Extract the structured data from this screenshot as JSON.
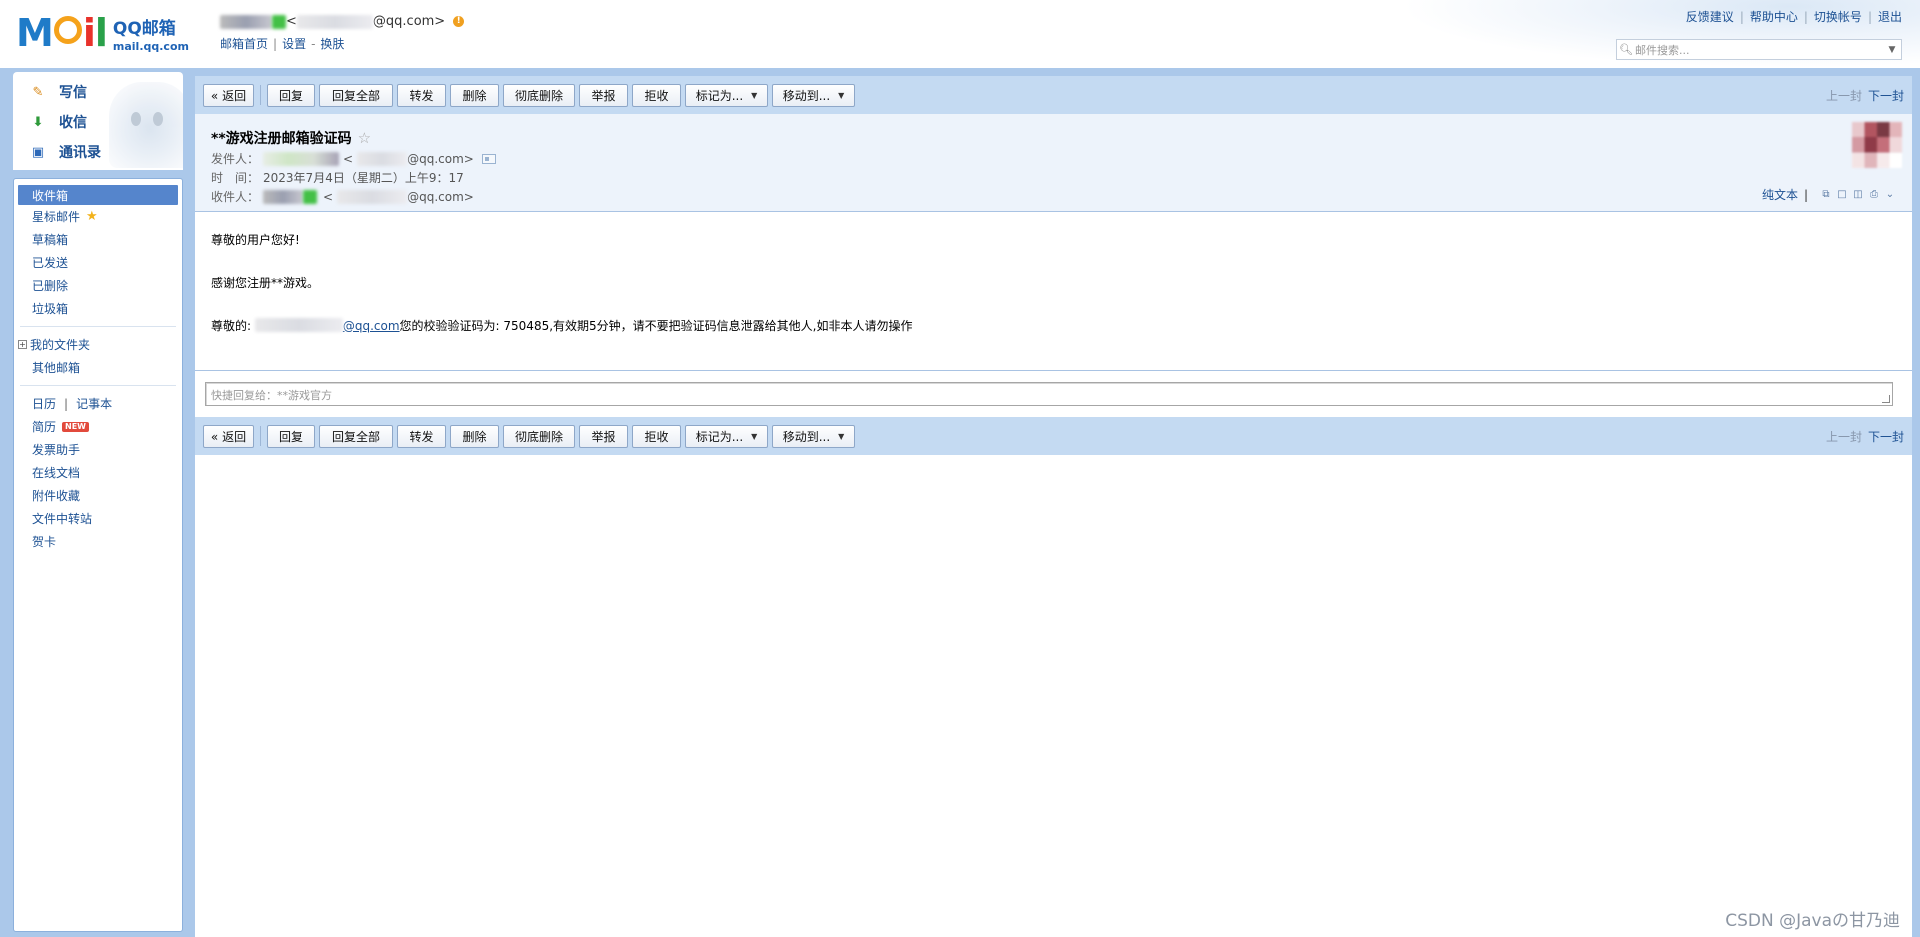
{
  "logo": {
    "mark": "M",
    "mark_i": "i",
    "mark_l": "l",
    "name_cn": "QQ邮箱",
    "domain": "mail.qq.com"
  },
  "account": {
    "email_suffix": "@qq.com>",
    "bracket": "<",
    "links": [
      "邮箱首页",
      "设置",
      "换肤"
    ],
    "sep1": "|",
    "sep2": "-"
  },
  "top_links": [
    "反馈建议",
    "帮助中心",
    "切换帐号",
    "退出"
  ],
  "top_sep": "|",
  "search": {
    "placeholder": "邮件搜索...",
    "icon": "search-icon"
  },
  "sidebar_top": {
    "write": "写信",
    "inbox": "收信",
    "contacts": "通讯录"
  },
  "sidebar": {
    "inbox": "收件箱",
    "starred": "星标邮件",
    "drafts": "草稿箱",
    "sent": "已发送",
    "deleted": "已删除",
    "spam": "垃圾箱",
    "my_folders": "我的文件夹",
    "other_mail": "其他邮箱",
    "calendar": "日历",
    "notes": "记事本",
    "nav_pipe": "|",
    "resume": "简历",
    "new_badge": "NEW",
    "invoice": "发票助手",
    "docs": "在线文档",
    "attachments": "附件收藏",
    "transfer": "文件中转站",
    "cards": "贺卡"
  },
  "toolbar": {
    "back": "« 返回",
    "reply": "回复",
    "reply_all": "回复全部",
    "forward": "转发",
    "delete": "删除",
    "delete_forever": "彻底删除",
    "report": "举报",
    "reject": "拒收",
    "mark_as": "标记为...",
    "move_to": "移动到...",
    "prev": "上一封",
    "next": "下一封"
  },
  "mail": {
    "subject": "**游戏注册邮箱验证码",
    "sender_label": "发件人：",
    "sender_email_suffix": "@qq.com>",
    "bracket": "<",
    "time_label": "时　间：",
    "time_value": "2023年7月4日（星期二）上午9：17",
    "recipient_label": "收件人：",
    "recipient_email_suffix": "@qq.com>",
    "plain_text": "纯文本",
    "tools_pipe": "|",
    "greeting": "尊敬的用户您好!",
    "thanks": "感谢您注册**游戏。",
    "code_prefix": "尊敬的: ",
    "code_email_suffix": "@qq.com",
    "code_text": "您的校验验证码为: 750485,有效期5分钟，请不要把验证码信息泄露给其他人,如非本人请勿操作"
  },
  "quick_reply": {
    "placeholder": "快捷回复给：**游戏官方"
  },
  "watermark": "CSDN @Javaの甘乃迪",
  "colors": {
    "frame": "#abc8ea",
    "toolbar": "#c4daf2",
    "link": "#1d5193",
    "active_nav": "#5585cc"
  }
}
